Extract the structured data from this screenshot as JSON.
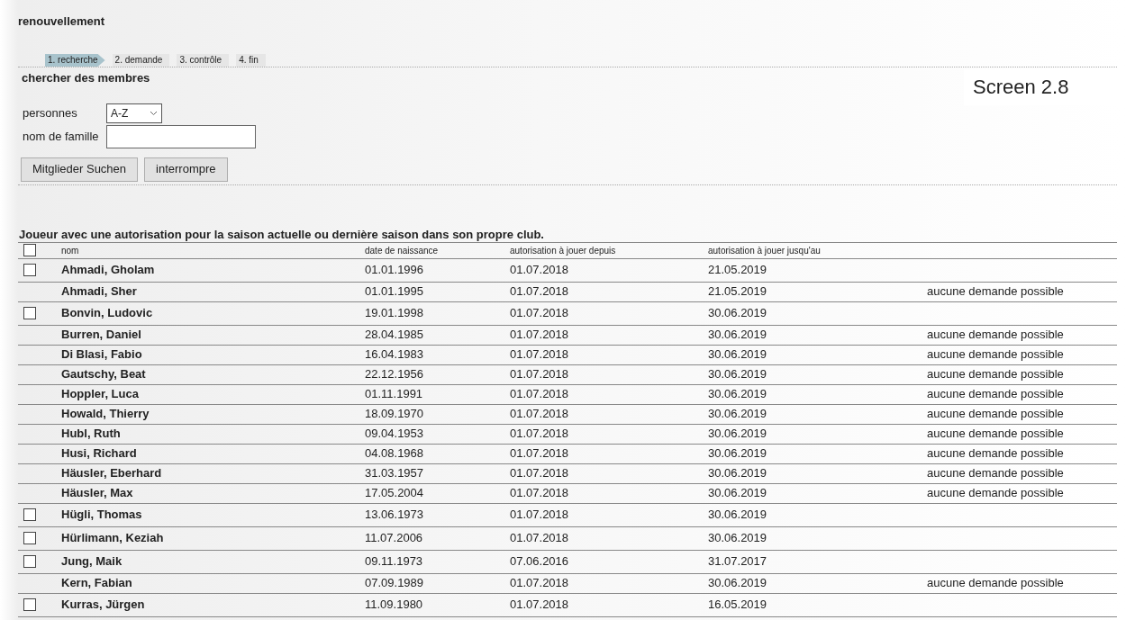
{
  "title": "renouvellement",
  "steps": [
    {
      "label": "1. recherche",
      "selected": true
    },
    {
      "label": "2. demande",
      "selected": false
    },
    {
      "label": "3. contrôle",
      "selected": false
    },
    {
      "label": "4. fin",
      "selected": false
    }
  ],
  "screen_label": "Screen 2.8",
  "search": {
    "heading": "chercher des membres",
    "persons_label": "personnes",
    "persons_value": "A-Z",
    "family_label": "nom de famille",
    "buttons": [
      "Mitglieder Suchen",
      "interrompre"
    ]
  },
  "table": {
    "caption": "Joueur avec une autorisation pour la saison actuelle ou dernière saison dans son propre club.",
    "header_checked": false,
    "columns": [
      "nom",
      "date de naissance",
      "autorisation à jouer depuis",
      "autorisation à jouer jusqu'au"
    ],
    "rows": [
      {
        "kind": "checkbox",
        "checked": false,
        "name": "Ahmadi, Gholam",
        "birth": "01.01.1996",
        "from": "01.07.2018",
        "until": "21.05.2019"
      },
      {
        "kind": "plain",
        "name": "Ahmadi, Sher",
        "birth": "01.01.1995",
        "from": "01.07.2018",
        "until": "21.05.2019",
        "note": "aucune demande possible"
      },
      {
        "kind": "checkbox",
        "checked": false,
        "name": "Bonvin, Ludovic",
        "birth": "19.01.1998",
        "from": "01.07.2018",
        "until": "30.06.2019"
      },
      {
        "kind": "plain",
        "name": "Burren, Daniel",
        "birth": "28.04.1985",
        "from": "01.07.2018",
        "until": "30.06.2019",
        "note": "aucune demande possible"
      },
      {
        "kind": "plain",
        "name": "Di Blasi, Fabio",
        "birth": "16.04.1983",
        "from": "01.07.2018",
        "until": "30.06.2019",
        "note": "aucune demande possible"
      },
      {
        "kind": "plain",
        "name": "Gautschy, Beat",
        "birth": "22.12.1956",
        "from": "01.07.2018",
        "until": "30.06.2019",
        "note": "aucune demande possible"
      },
      {
        "kind": "plain",
        "name": "Hoppler, Luca",
        "birth": "01.11.1991",
        "from": "01.07.2018",
        "until": "30.06.2019",
        "note": "aucune demande possible"
      },
      {
        "kind": "plain",
        "name": "Howald, Thierry",
        "birth": "18.09.1970",
        "from": "01.07.2018",
        "until": "30.06.2019",
        "note": "aucune demande possible"
      },
      {
        "kind": "plain",
        "name": "Hubl, Ruth",
        "birth": "09.04.1953",
        "from": "01.07.2018",
        "until": "30.06.2019",
        "note": "aucune demande possible"
      },
      {
        "kind": "plain",
        "name": "Husi, Richard",
        "birth": "04.08.1968",
        "from": "01.07.2018",
        "until": "30.06.2019",
        "note": "aucune demande possible"
      },
      {
        "kind": "plain",
        "name": "Häusler, Eberhard",
        "birth": "31.03.1957",
        "from": "01.07.2018",
        "until": "30.06.2019",
        "note": "aucune demande possible"
      },
      {
        "kind": "plain",
        "name": "Häusler, Max",
        "birth": "17.05.2004",
        "from": "01.07.2018",
        "until": "30.06.2019",
        "note": "aucune demande possible"
      },
      {
        "kind": "checkbox",
        "checked": false,
        "name": "Hügli, Thomas",
        "birth": "13.06.1973",
        "from": "01.07.2018",
        "until": "30.06.2019"
      },
      {
        "kind": "checkbox",
        "checked": false,
        "name": "Hürlimann, Keziah",
        "birth": "11.07.2006",
        "from": "01.07.2018",
        "until": "30.06.2019"
      },
      {
        "kind": "checkbox",
        "checked": false,
        "name": "Jung, Maik",
        "birth": "09.11.1973",
        "from": "07.06.2016",
        "until": "31.07.2017"
      },
      {
        "kind": "plain",
        "name": "Kern, Fabian",
        "birth": "07.09.1989",
        "from": "01.07.2018",
        "until": "30.06.2019",
        "note": "aucune demande possible"
      },
      {
        "kind": "checkbox",
        "checked": false,
        "name": "Kurras, Jürgen",
        "birth": "11.09.1980",
        "from": "01.07.2018",
        "until": "16.05.2019"
      }
    ]
  }
}
